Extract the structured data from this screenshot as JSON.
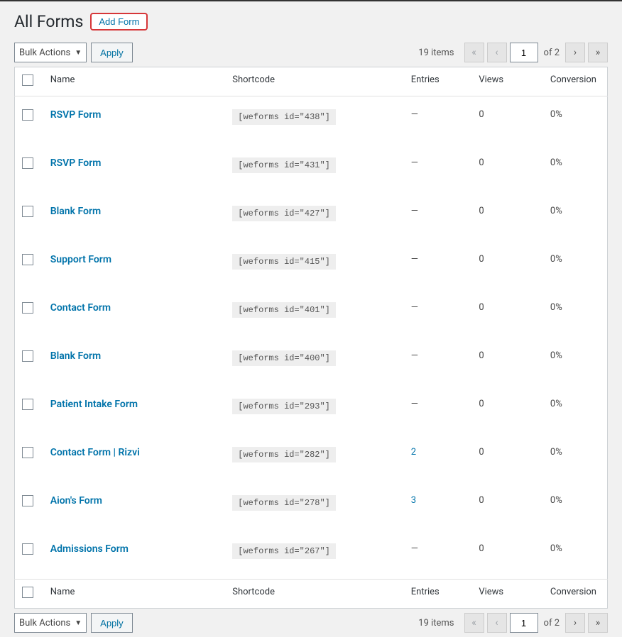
{
  "header": {
    "title": "All Forms",
    "add_button": "Add Form"
  },
  "bulk": {
    "label": "Bulk Actions",
    "apply": "Apply"
  },
  "pagination": {
    "items_text": "19 items",
    "current_page": "1",
    "of_text": "of 2"
  },
  "columns": {
    "name": "Name",
    "shortcode": "Shortcode",
    "entries": "Entries",
    "views": "Views",
    "conversion": "Conversion"
  },
  "rows": [
    {
      "name": "RSVP Form",
      "shortcode": "[weforms id=\"438\"]",
      "entries": "—",
      "entries_link": false,
      "views": "0",
      "conversion": "0%"
    },
    {
      "name": "RSVP Form",
      "shortcode": "[weforms id=\"431\"]",
      "entries": "—",
      "entries_link": false,
      "views": "0",
      "conversion": "0%"
    },
    {
      "name": "Blank Form",
      "shortcode": "[weforms id=\"427\"]",
      "entries": "—",
      "entries_link": false,
      "views": "0",
      "conversion": "0%"
    },
    {
      "name": "Support Form",
      "shortcode": "[weforms id=\"415\"]",
      "entries": "—",
      "entries_link": false,
      "views": "0",
      "conversion": "0%"
    },
    {
      "name": "Contact Form",
      "shortcode": "[weforms id=\"401\"]",
      "entries": "—",
      "entries_link": false,
      "views": "0",
      "conversion": "0%"
    },
    {
      "name": "Blank Form",
      "shortcode": "[weforms id=\"400\"]",
      "entries": "—",
      "entries_link": false,
      "views": "0",
      "conversion": "0%"
    },
    {
      "name": "Patient Intake Form",
      "shortcode": "[weforms id=\"293\"]",
      "entries": "—",
      "entries_link": false,
      "views": "0",
      "conversion": "0%"
    },
    {
      "name": "Contact Form | Rizvi",
      "shortcode": "[weforms id=\"282\"]",
      "entries": "2",
      "entries_link": true,
      "views": "0",
      "conversion": "0%"
    },
    {
      "name": "Aion's Form",
      "shortcode": "[weforms id=\"278\"]",
      "entries": "3",
      "entries_link": true,
      "views": "0",
      "conversion": "0%"
    },
    {
      "name": "Admissions Form",
      "shortcode": "[weforms id=\"267\"]",
      "entries": "—",
      "entries_link": false,
      "views": "0",
      "conversion": "0%"
    }
  ]
}
